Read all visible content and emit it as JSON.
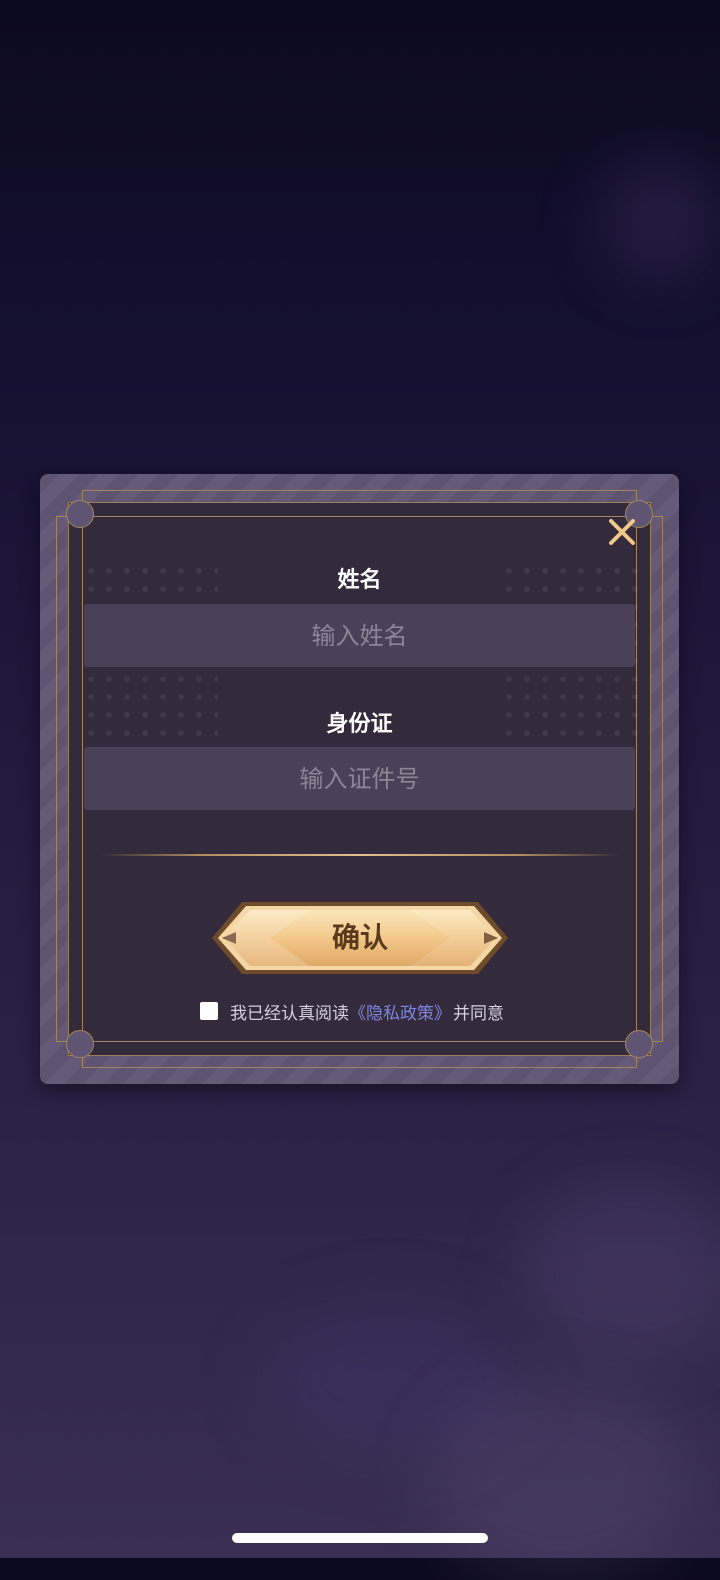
{
  "dialog": {
    "close_icon": "close-icon",
    "name_label": "姓名",
    "name_placeholder": "输入姓名",
    "id_label": "身份证",
    "id_placeholder": "输入证件号",
    "confirm_label": "确认",
    "agreement": {
      "checked": false,
      "prefix": "我已经认真阅读",
      "policy_link": "《隐私政策》",
      "suffix": "并同意"
    }
  },
  "colors": {
    "accent_gold": "#f2c88a",
    "link_blue": "#7f86e0",
    "panel_bg": "#332a3b"
  }
}
